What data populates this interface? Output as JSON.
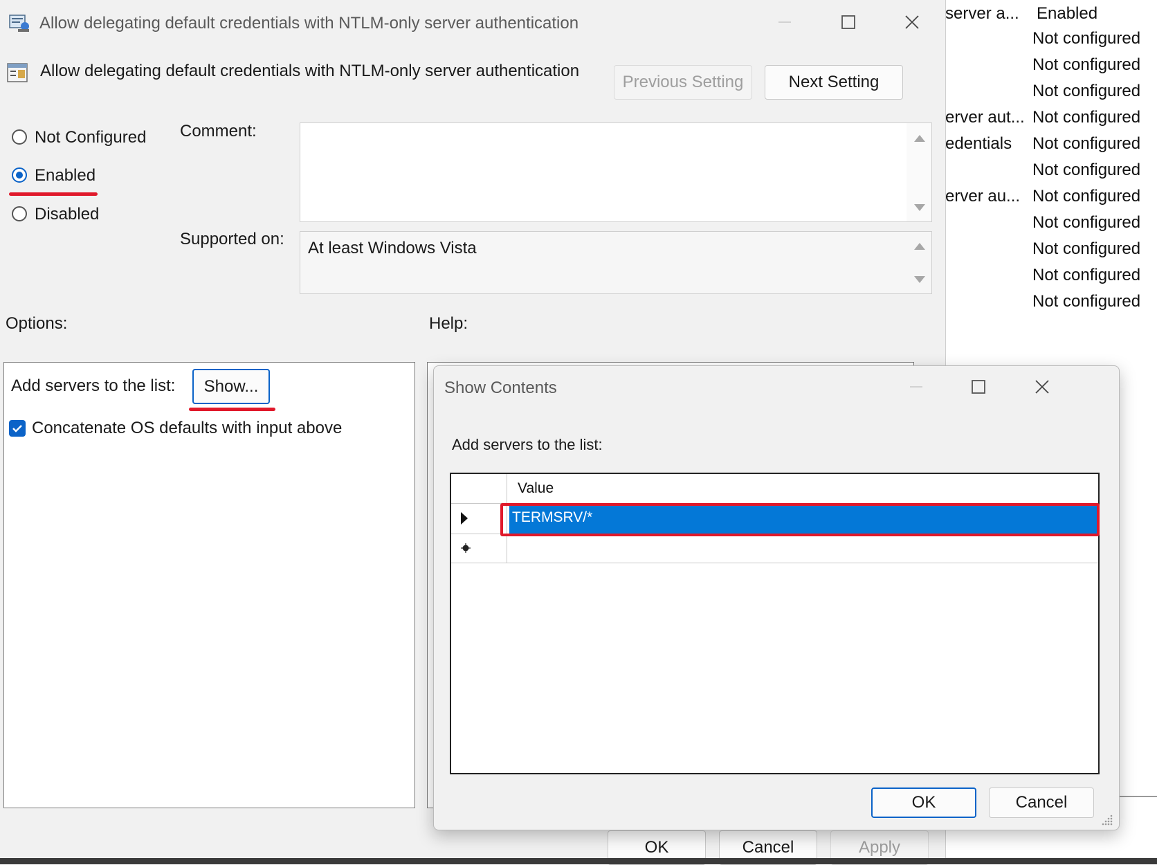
{
  "background_list": {
    "header": {
      "name_fragment": "server a...",
      "state_label": "Enabled"
    },
    "rows": [
      {
        "name_fragment": "",
        "state": "Not configured"
      },
      {
        "name_fragment": "",
        "state": "Not configured"
      },
      {
        "name_fragment": "",
        "state": "Not configured"
      },
      {
        "name_fragment": "erver aut...",
        "state": "Not configured"
      },
      {
        "name_fragment": "edentials",
        "state": "Not configured"
      },
      {
        "name_fragment": "",
        "state": "Not configured"
      },
      {
        "name_fragment": "erver au...",
        "state": "Not configured"
      },
      {
        "name_fragment": "",
        "state": "Not configured"
      },
      {
        "name_fragment": "",
        "state": "Not configured"
      },
      {
        "name_fragment": "",
        "state": "Not configured"
      },
      {
        "name_fragment": "",
        "state": "Not configured"
      }
    ]
  },
  "main_dialog": {
    "window_title": "Allow delegating default credentials with NTLM-only server authentication",
    "policy_title": "Allow delegating default credentials with NTLM-only server authentication",
    "previous_setting": "Previous Setting",
    "next_setting": "Next Setting",
    "radio_options": [
      {
        "label": "Not Configured",
        "selected": false
      },
      {
        "label": "Enabled",
        "selected": true
      },
      {
        "label": "Disabled",
        "selected": false
      }
    ],
    "comment_label": "Comment:",
    "comment_value": "",
    "supported_on_label": "Supported on:",
    "supported_on_value": "At least Windows Vista",
    "options_label": "Options:",
    "help_label": "Help:",
    "add_servers_label": "Add servers to the list:",
    "show_button": "Show...",
    "concatenate_label": "Concatenate OS defaults with input above",
    "concatenate_checked": true,
    "ok": "OK",
    "cancel": "Cancel",
    "apply": "Apply"
  },
  "show_contents": {
    "window_title": "Show Contents",
    "instruction": "Add servers to the list:",
    "column_header": "Value",
    "rows": [
      {
        "value": "TERMSRV/*",
        "selected": true
      }
    ],
    "ok": "OK",
    "cancel": "Cancel"
  },
  "colors": {
    "accent": "#0b63c8",
    "selection": "#0478d7",
    "highlight_annotation": "#e0192b"
  }
}
